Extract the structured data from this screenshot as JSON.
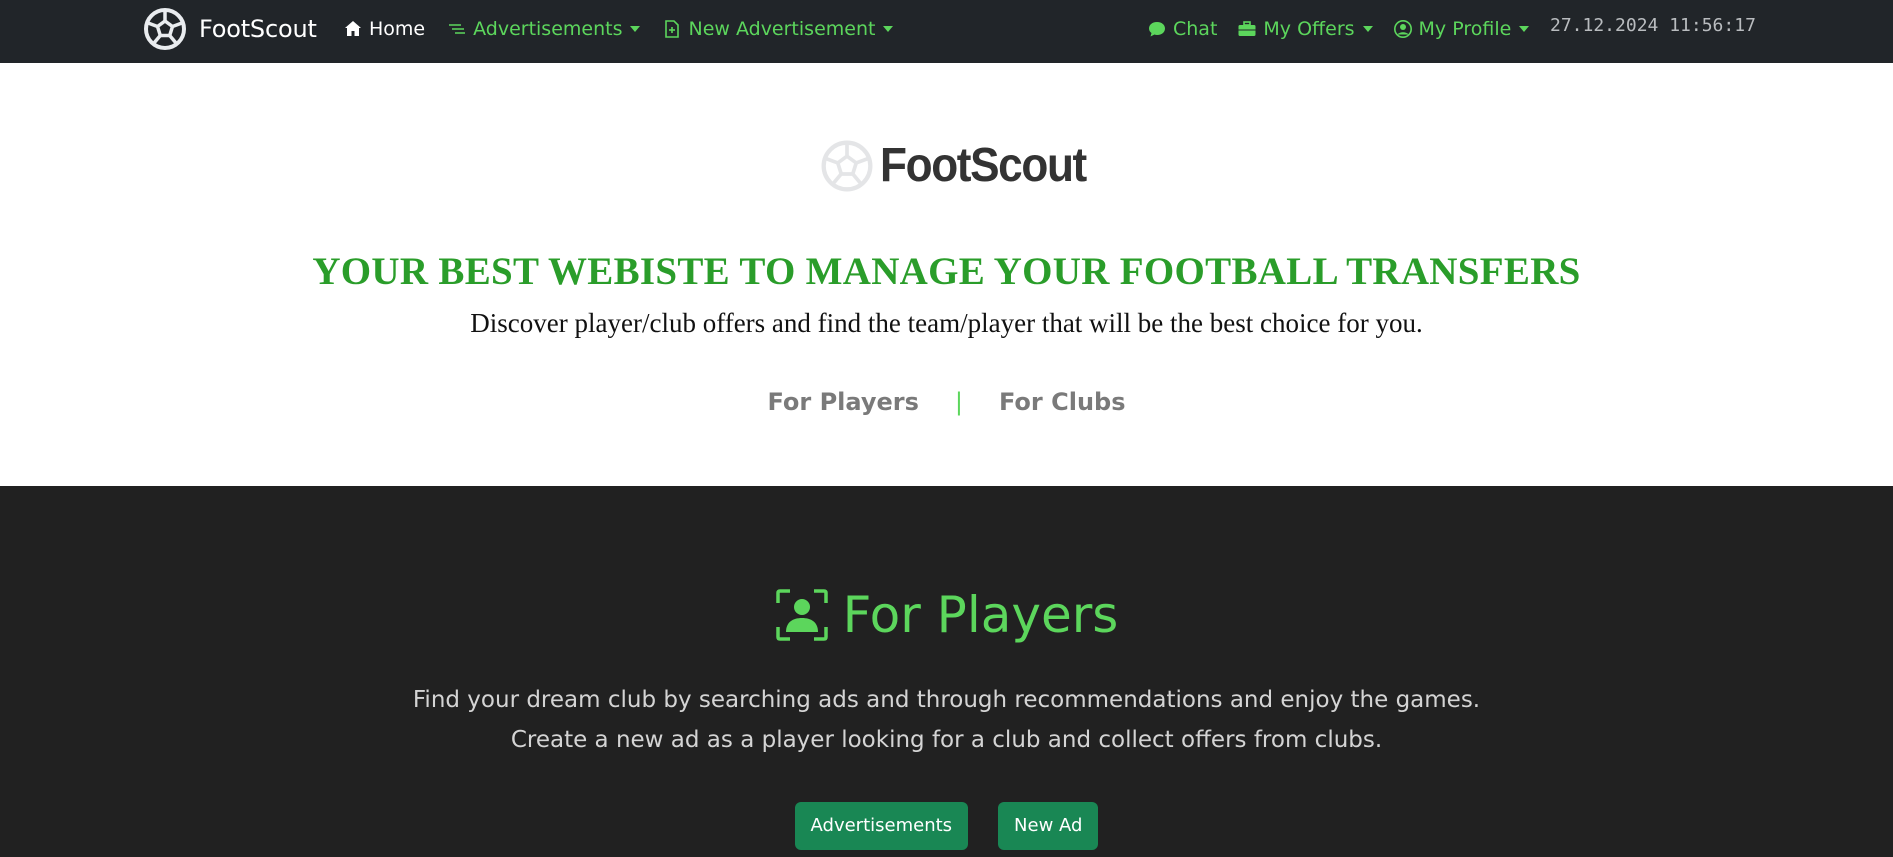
{
  "navbar": {
    "brand": "FootScout",
    "home": "Home",
    "advertisements": "Advertisements",
    "new_advertisement": "New Advertisement",
    "chat": "Chat",
    "my_offers": "My Offers",
    "my_profile": "My Profile",
    "datetime": "27.12.2024 11:56:17"
  },
  "hero": {
    "logo_text": "FootScout",
    "title": "YOUR BEST WEBISTE TO MANAGE YOUR FOOTBALL TRANSFERS",
    "subtitle": "Discover player/club offers and find the team/player that will be the best choice for you.",
    "link_players": "For Players",
    "separator": "|",
    "link_clubs": "For Clubs"
  },
  "players_section": {
    "title": "For Players",
    "line1": "Find your dream club by searching ads and through recommendations and enjoy the games.",
    "line2": "Create a new ad as a player looking for a club and collect offers from clubs.",
    "btn_advertisements": "Advertisements",
    "btn_new_ad": "New Ad"
  },
  "colors": {
    "navbar_bg": "#212529",
    "accent_green": "#5cd65c",
    "title_green": "#2a9d2a",
    "button_green": "#198754",
    "section_dark": "#212121"
  },
  "icons": {
    "brand": "soccer-ball-icon",
    "home": "house-icon",
    "advertisements": "list-lines-icon",
    "new_advertisement": "file-plus-icon",
    "chat": "chat-bubble-icon",
    "my_offers": "briefcase-icon",
    "my_profile": "person-circle-icon",
    "players": "person-badge-icon"
  }
}
